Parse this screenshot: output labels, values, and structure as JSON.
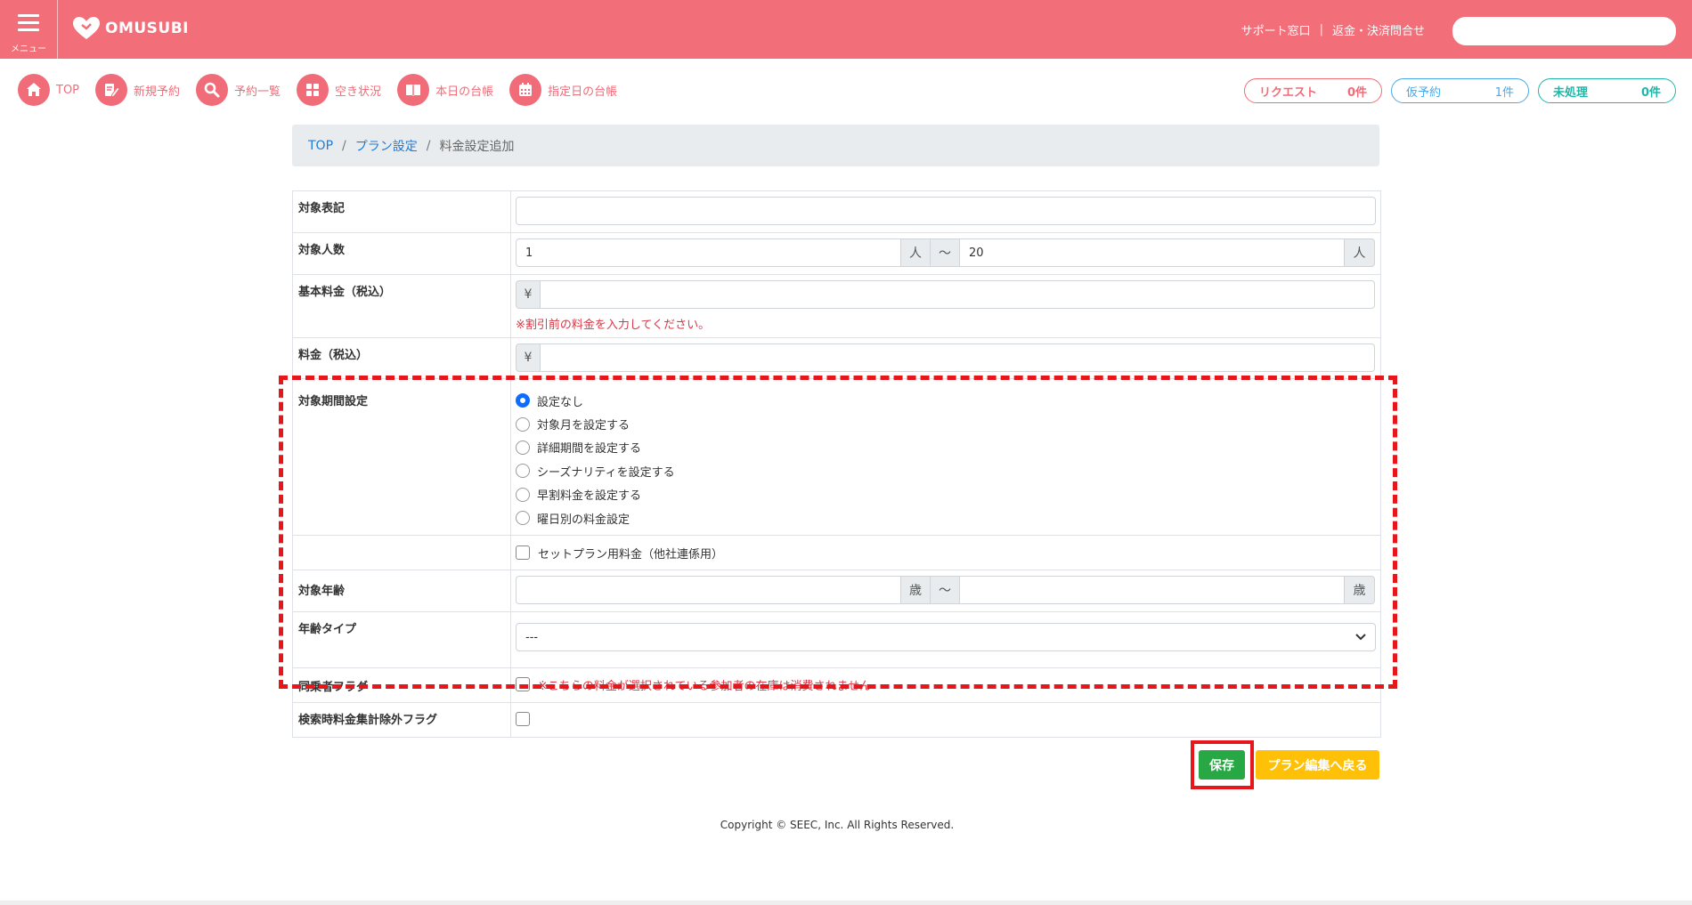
{
  "header": {
    "menu_label": "メニュー",
    "logo_text": "OMUSUBI",
    "support_link": "サポート窓口",
    "divider": "|",
    "refund_link": "返金・決済問合せ",
    "search_placeholder": ""
  },
  "nav": {
    "items": [
      {
        "label": "TOP",
        "icon": "home-icon"
      },
      {
        "label": "新規予約",
        "icon": "edit-icon"
      },
      {
        "label": "予約一覧",
        "icon": "search-icon"
      },
      {
        "label": "空き状況",
        "icon": "grid-icon"
      },
      {
        "label": "本日の台帳",
        "icon": "book-icon"
      },
      {
        "label": "指定日の台帳",
        "icon": "calendar-icon"
      }
    ],
    "pills": {
      "request_label": "リクエスト",
      "request_count": "0件",
      "tentative_label": "仮予約",
      "tentative_count": "1件",
      "pending_label": "未処理",
      "pending_count": "0件"
    }
  },
  "breadcrumb": {
    "top": "TOP",
    "plan_settings": "プラン設定",
    "separator": "/",
    "current": "料金設定追加"
  },
  "form": {
    "target_label": "対象表記",
    "target_value": "",
    "people_label": "対象人数",
    "people_min": "1",
    "people_unit": "人",
    "range_sep": "〜",
    "people_max": "20",
    "base_price_label": "基本料金（税込）",
    "yen": "¥",
    "base_price_value": "",
    "base_price_note": "※割引前の料金を入力してください。",
    "price_label": "料金（税込）",
    "price_value": "",
    "period_label": "対象期間設定",
    "period_options": [
      {
        "label": "設定なし",
        "checked": true
      },
      {
        "label": "対象月を設定する",
        "checked": false
      },
      {
        "label": "詳細期間を設定する",
        "checked": false
      },
      {
        "label": "シーズナリティを設定する",
        "checked": false
      },
      {
        "label": "早割料金を設定する",
        "checked": false
      },
      {
        "label": "曜日別の料金設定",
        "checked": false
      }
    ],
    "set_plan_label": "セットプラン用料金（他社連係用）",
    "age_label": "対象年齢",
    "age_unit": "歳",
    "age_min": "",
    "age_max": "",
    "age_type_label": "年齢タイプ",
    "age_type_value": "---",
    "companion_label": "同乗者フラグ",
    "companion_note": "※こちらの料金が選択されている参加者の在庫は消費されません",
    "search_exclude_label": "検索時料金集計除外フラグ"
  },
  "actions": {
    "save": "保存",
    "back": "プラン編集へ戻る"
  },
  "footer": {
    "copyright": "Copyright © SEEC, Inc. All Rights Reserved."
  },
  "colors": {
    "brand": "#f26f7a",
    "highlight": "#e6161b",
    "save": "#28a745",
    "back": "#ffc107"
  }
}
